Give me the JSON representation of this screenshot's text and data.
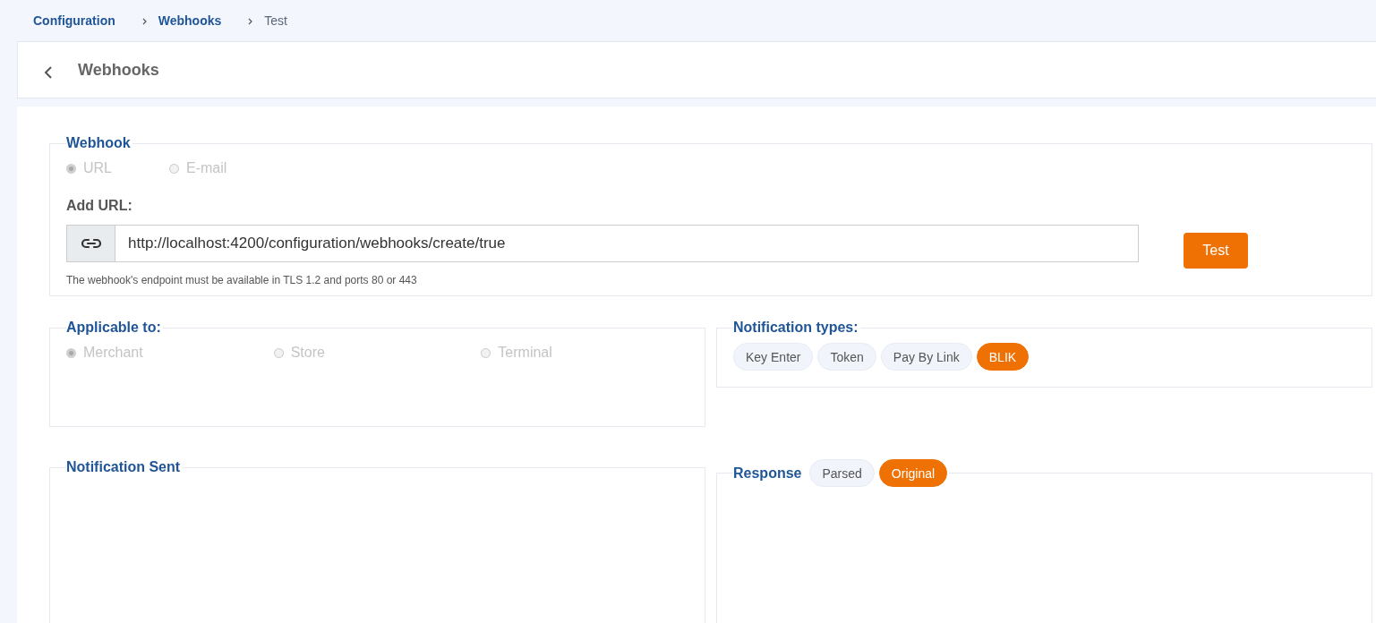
{
  "breadcrumb": [
    {
      "label": "Configuration",
      "current": false
    },
    {
      "label": "Webhooks",
      "current": false
    },
    {
      "label": "Test",
      "current": true
    }
  ],
  "header": {
    "title": "Webhooks"
  },
  "webhook": {
    "legend": "Webhook",
    "disabled": true,
    "options": [
      {
        "label": "URL",
        "selected": true
      },
      {
        "label": "E-mail",
        "selected": false
      }
    ],
    "url_label": "Add URL:",
    "url_value": "http://localhost:4200/configuration/webhooks/create/true",
    "hint": "The webhook's endpoint must be available in TLS 1.2 and ports 80 or 443",
    "test_button": "Test"
  },
  "applicable": {
    "legend": "Applicable to:",
    "disabled": true,
    "options": [
      {
        "label": "Merchant",
        "selected": true
      },
      {
        "label": "Store",
        "selected": false
      },
      {
        "label": "Terminal",
        "selected": false
      }
    ]
  },
  "notification_types": {
    "legend": "Notification types:",
    "chips": [
      {
        "label": "Key Enter",
        "selected": false
      },
      {
        "label": "Token",
        "selected": false
      },
      {
        "label": "Pay By Link",
        "selected": false
      },
      {
        "label": "BLIK",
        "selected": true
      }
    ]
  },
  "notification_sent": {
    "legend": "Notification Sent"
  },
  "response": {
    "legend": "Response",
    "tabs": [
      {
        "label": "Parsed",
        "selected": false
      },
      {
        "label": "Original",
        "selected": true
      }
    ]
  }
}
